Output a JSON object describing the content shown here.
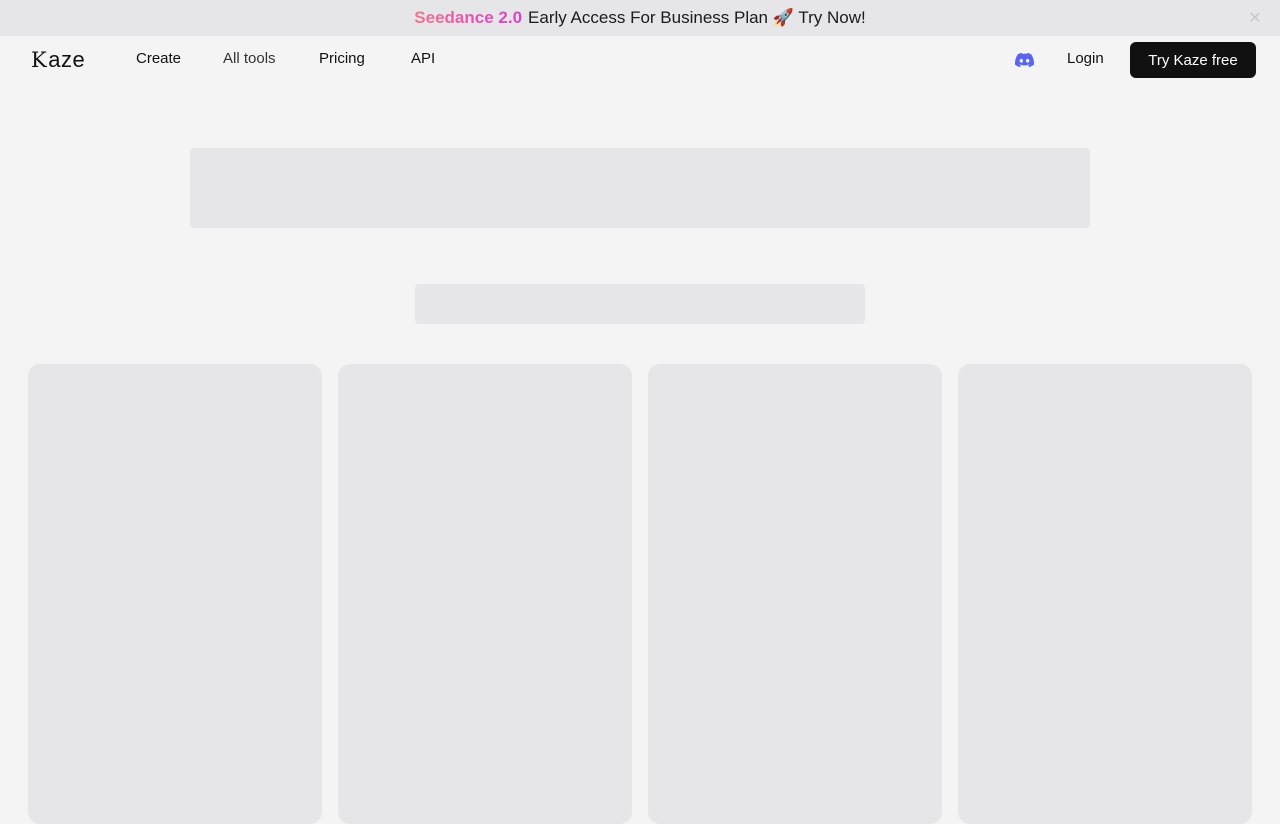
{
  "banner": {
    "promo_label": "Seedance 2.0",
    "message": "Early Access For Business Plan 🚀 Try Now!",
    "close_icon": "close-icon",
    "promo_gradient": [
      "#f0758f",
      "#d93fd0"
    ]
  },
  "nav": {
    "logo_k": "K",
    "logo_rest": "aze",
    "links": [
      {
        "label": "Create"
      },
      {
        "label": "All tools"
      },
      {
        "label": "Pricing"
      },
      {
        "label": "API"
      }
    ],
    "discord_icon": "discord-icon",
    "login_label": "Login",
    "cta_label": "Try Kaze free"
  },
  "colors": {
    "background": "#f4f4f4",
    "skeleton": "#e6e6e8",
    "cta_bg": "#111111",
    "discord": "#5865f2"
  }
}
